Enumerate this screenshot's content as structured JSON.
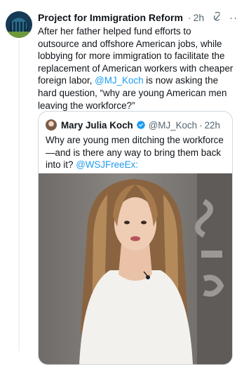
{
  "tweet": {
    "author_name": "Project for Immigration Reform",
    "separator": "·",
    "time": "2h",
    "text_part1": "After her father helped fund efforts to outsource and offshore American jobs, while lobbying for more immigration to facilitate the replacement of American workers with cheaper foreign labor, ",
    "mention": "@MJ_Koch",
    "text_part2": " is now asking the hard question, “why are young American men leaving the workforce?”"
  },
  "quote": {
    "author_name": "Mary Julia Koch",
    "handle": "@MJ_Koch",
    "separator": "·",
    "time": "22h",
    "text": "Why are young men ditching the workforce—and is there any way to bring them back into it? ",
    "mention": "@WSJFreeEx:"
  },
  "icons": {
    "verified": "verified-badge-icon",
    "grok": "grok-icon",
    "more": "more-options-icon"
  },
  "colors": {
    "accent": "#1d9bf0",
    "text": "#0f1419",
    "secondary": "#536471",
    "border": "#cfd9de"
  }
}
